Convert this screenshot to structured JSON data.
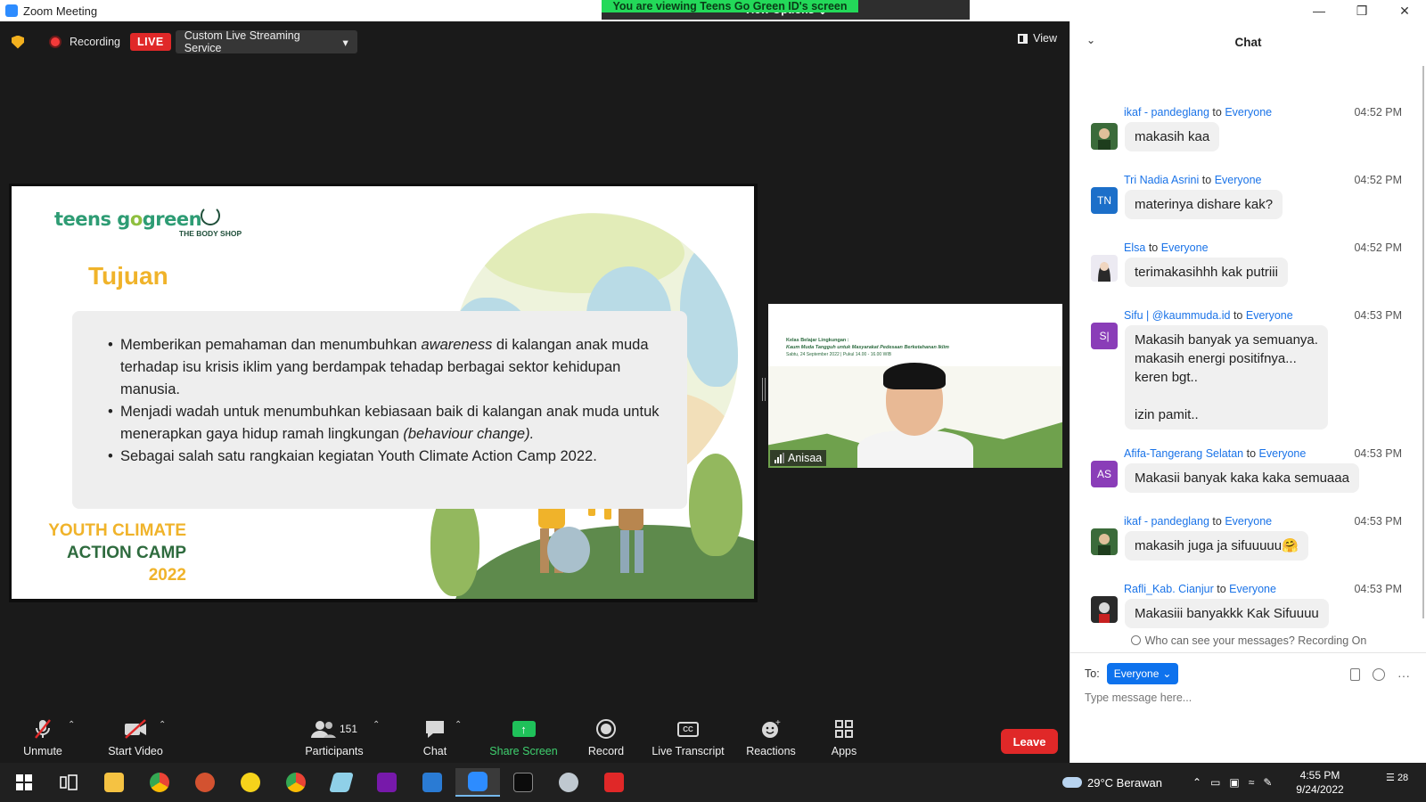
{
  "window": {
    "title": "Zoom Meeting",
    "banner_text": "You are viewing Teens Go Green ID's screen",
    "view_options": "View Options",
    "minimize": "—",
    "restore": "❒",
    "close": "✕"
  },
  "meeting_top": {
    "recording_label": "Recording",
    "live_badge": "LIVE",
    "stream_service": "Custom Live Streaming Service",
    "view_label": "View"
  },
  "slide": {
    "logo_teens_1": "teens g",
    "logo_teens_2": "o",
    "logo_teens_3": "green",
    "logo_bodyshop": "THE BODY SHOP",
    "title": "Tujuan",
    "bullet1_pre": "Memberikan pemahaman dan menumbuhkan ",
    "bullet1_em": "awareness",
    "bullet1_post": " di kalangan anak muda terhadap isu krisis iklim yang berdampak tehadap berbagai sektor kehidupan manusia.",
    "bullet2_pre": "Menjadi wadah untuk menumbuhkan kebiasaan baik di kalangan anak muda untuk menerapkan gaya hidup ramah lingkungan ",
    "bullet2_em": "(behaviour change).",
    "bullet3": "Sebagai salah satu rangkaian kegiatan Youth Climate Action Camp 2022.",
    "camp_l1": "YOUTH CLIMATE",
    "camp_l2": "ACTION CAMP",
    "camp_l3": "2022"
  },
  "video": {
    "name": "Anisaa",
    "line1": "Kelas Belajar Lingkungan :",
    "line2": "Kaum Muda Tangguh untuk Masyarakat Pedesaan Berketahanan Iklim",
    "line3": "Sabtu, 24 September 2022 | Pukul 14.00 - 16.00 WIB"
  },
  "toolbar": {
    "unmute": "Unmute",
    "start_video": "Start Video",
    "participants": "Participants",
    "participants_count": "151",
    "chat": "Chat",
    "share_screen": "Share Screen",
    "record": "Record",
    "live_transcript": "Live Transcript",
    "cc": "CC",
    "reactions": "Reactions",
    "apps": "Apps",
    "leave": "Leave"
  },
  "chat": {
    "title": "Chat",
    "to_word": "to",
    "messages": [
      {
        "sender": "ikaf - pandeglang",
        "to": "Everyone",
        "time": "04:52 PM",
        "text": "makasih kaa",
        "initials": "",
        "color": "#3b6b3a"
      },
      {
        "sender": "Tri Nadia Asrini",
        "to": "Everyone",
        "time": "04:52 PM",
        "text": "materinya dishare kak?",
        "initials": "TN",
        "color": "#1c6fc9"
      },
      {
        "sender": "Elsa",
        "to": "Everyone",
        "time": "04:52 PM",
        "text": "terimakasihhh kak putriii",
        "initials": "",
        "color": "#e8e4f0"
      },
      {
        "sender": "Sifu | @kaummuda.id",
        "to": "Everyone",
        "time": "04:53 PM",
        "text": "Makasih banyak ya semuanya.\nmakasih energi positifnya...\nkeren bgt..\n\nizin pamit..",
        "initials": "S|",
        "color": "#8a3db8"
      },
      {
        "sender": "Afifa-Tangerang Selatan",
        "to": "Everyone",
        "time": "04:53 PM",
        "text": "Makasii banyak kaka kaka semuaaa",
        "initials": "AS",
        "color": "#8a3db8"
      },
      {
        "sender": "ikaf - pandeglang",
        "to": "Everyone",
        "time": "04:53 PM",
        "text": "makasih juga ja sifuuuuu🤗",
        "initials": "",
        "color": "#3b6b3a"
      },
      {
        "sender": "Rafli_Kab. Cianjur",
        "to": "Everyone",
        "time": "04:53 PM",
        "text": "Makasiii banyakkk Kak Sifuuuu",
        "initials": "",
        "color": "#2a2a2a"
      }
    ],
    "who_sees": "Who can see your messages? Recording On",
    "to_label": "To:",
    "to_value": "Everyone",
    "placeholder": "Type message here...",
    "more": "···"
  },
  "taskbar": {
    "weather": "29°C  Berawan",
    "time": "4:55 PM",
    "date": "9/24/2022",
    "notif_count": "28"
  }
}
